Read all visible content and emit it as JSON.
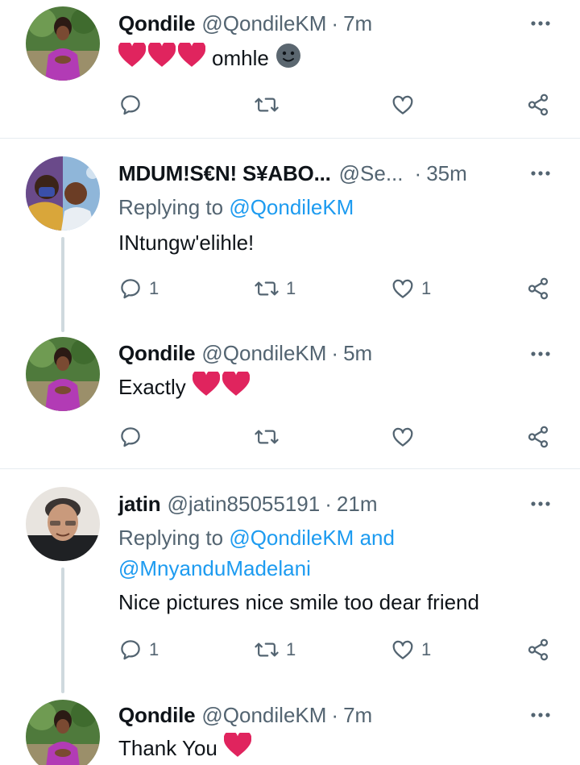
{
  "tweets": [
    {
      "name": "Qondile",
      "handle": "@QondileKM",
      "time": "7m",
      "text": "omhle",
      "emoji": [
        "red-heart",
        "red-heart",
        "red-heart",
        "slightly-smiling-face"
      ],
      "counts": {
        "replies": "",
        "retweets": "",
        "likes": ""
      }
    },
    {
      "name": "MDUM!S€N! S¥ABO...",
      "handle": "@Se...",
      "time": "35m",
      "replying_prefix": "Replying to",
      "replying_to": [
        "@QondileKM"
      ],
      "text": "INtungw'elihle!",
      "counts": {
        "replies": "1",
        "retweets": "1",
        "likes": "1"
      }
    },
    {
      "name": "Qondile",
      "handle": "@QondileKM",
      "time": "5m",
      "text": "Exactly",
      "emoji": [
        "red-heart",
        "red-heart"
      ],
      "counts": {
        "replies": "",
        "retweets": "",
        "likes": ""
      }
    },
    {
      "name": "jatin",
      "handle": "@jatin85055191",
      "time": "21m",
      "replying_prefix": "Replying to",
      "replying_to": [
        "@QondileKM",
        "@MnyanduMadelani"
      ],
      "replying_joiner": "and",
      "text": "Nice pictures nice smile too dear friend",
      "counts": {
        "replies": "1",
        "retweets": "1",
        "likes": "1"
      }
    },
    {
      "name": "Qondile",
      "handle": "@QondileKM",
      "time": "7m",
      "text": "Thank You",
      "emoji": [
        "red-heart"
      ]
    }
  ],
  "separator": "·",
  "colors": {
    "accent": "#1d9bf0",
    "heart": "#e0245e",
    "muted": "#536471",
    "divider": "#e6ecf0"
  }
}
